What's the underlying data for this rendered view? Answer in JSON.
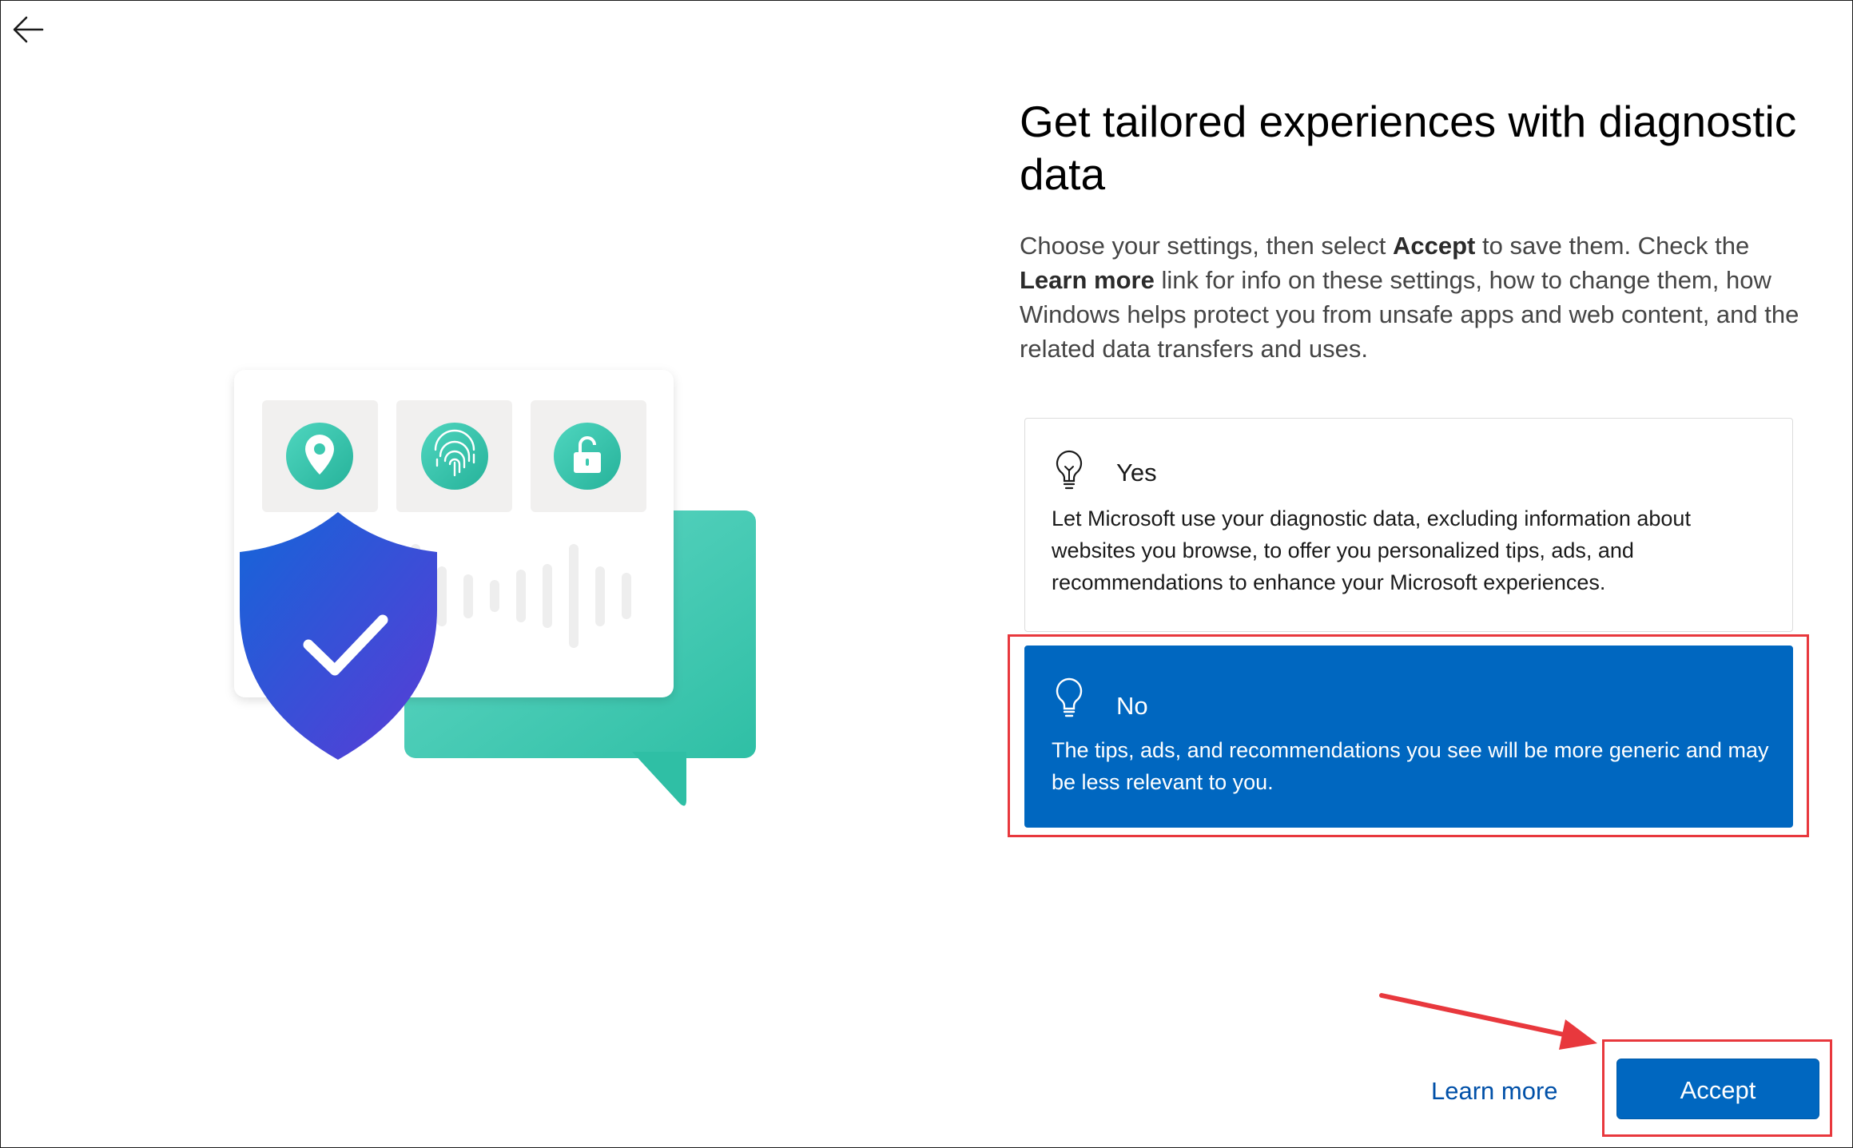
{
  "header": {
    "back_icon": "back-arrow-icon"
  },
  "main": {
    "title": "Get tailored experiences with diagnostic data",
    "description": {
      "part1": "Choose your settings, then select ",
      "accept_bold": "Accept",
      "part2": " to save them. Check the ",
      "learn_more_bold": "Learn more",
      "part3": " link for info on these settings, how to change them, how Windows helps protect you from unsafe apps and web content, and the related data transfers and uses."
    },
    "options": [
      {
        "label": "Yes",
        "description": "Let Microsoft use your diagnostic data, excluding information about websites you browse, to offer you personalized tips, ads, and recommendations to enhance your Microsoft experiences.",
        "icon": "lightbulb-on-icon",
        "selected": false
      },
      {
        "label": "No",
        "description": "The tips, ads, and recommendations you see will be more generic and may be less relevant to you.",
        "icon": "lightbulb-icon",
        "selected": true
      }
    ]
  },
  "footer": {
    "learn_more_label": "Learn more",
    "accept_label": "Accept"
  },
  "illustration": {
    "icons": [
      "location-pin-icon",
      "fingerprint-icon",
      "unlock-icon",
      "shield-check-icon",
      "chat-bubble-icon"
    ]
  },
  "colors": {
    "accent": "#0067c0",
    "annotation": "#e8383d",
    "teal": "#3cc9b0",
    "shield_top": "#1565d8",
    "shield_bottom": "#5a3bd6"
  }
}
